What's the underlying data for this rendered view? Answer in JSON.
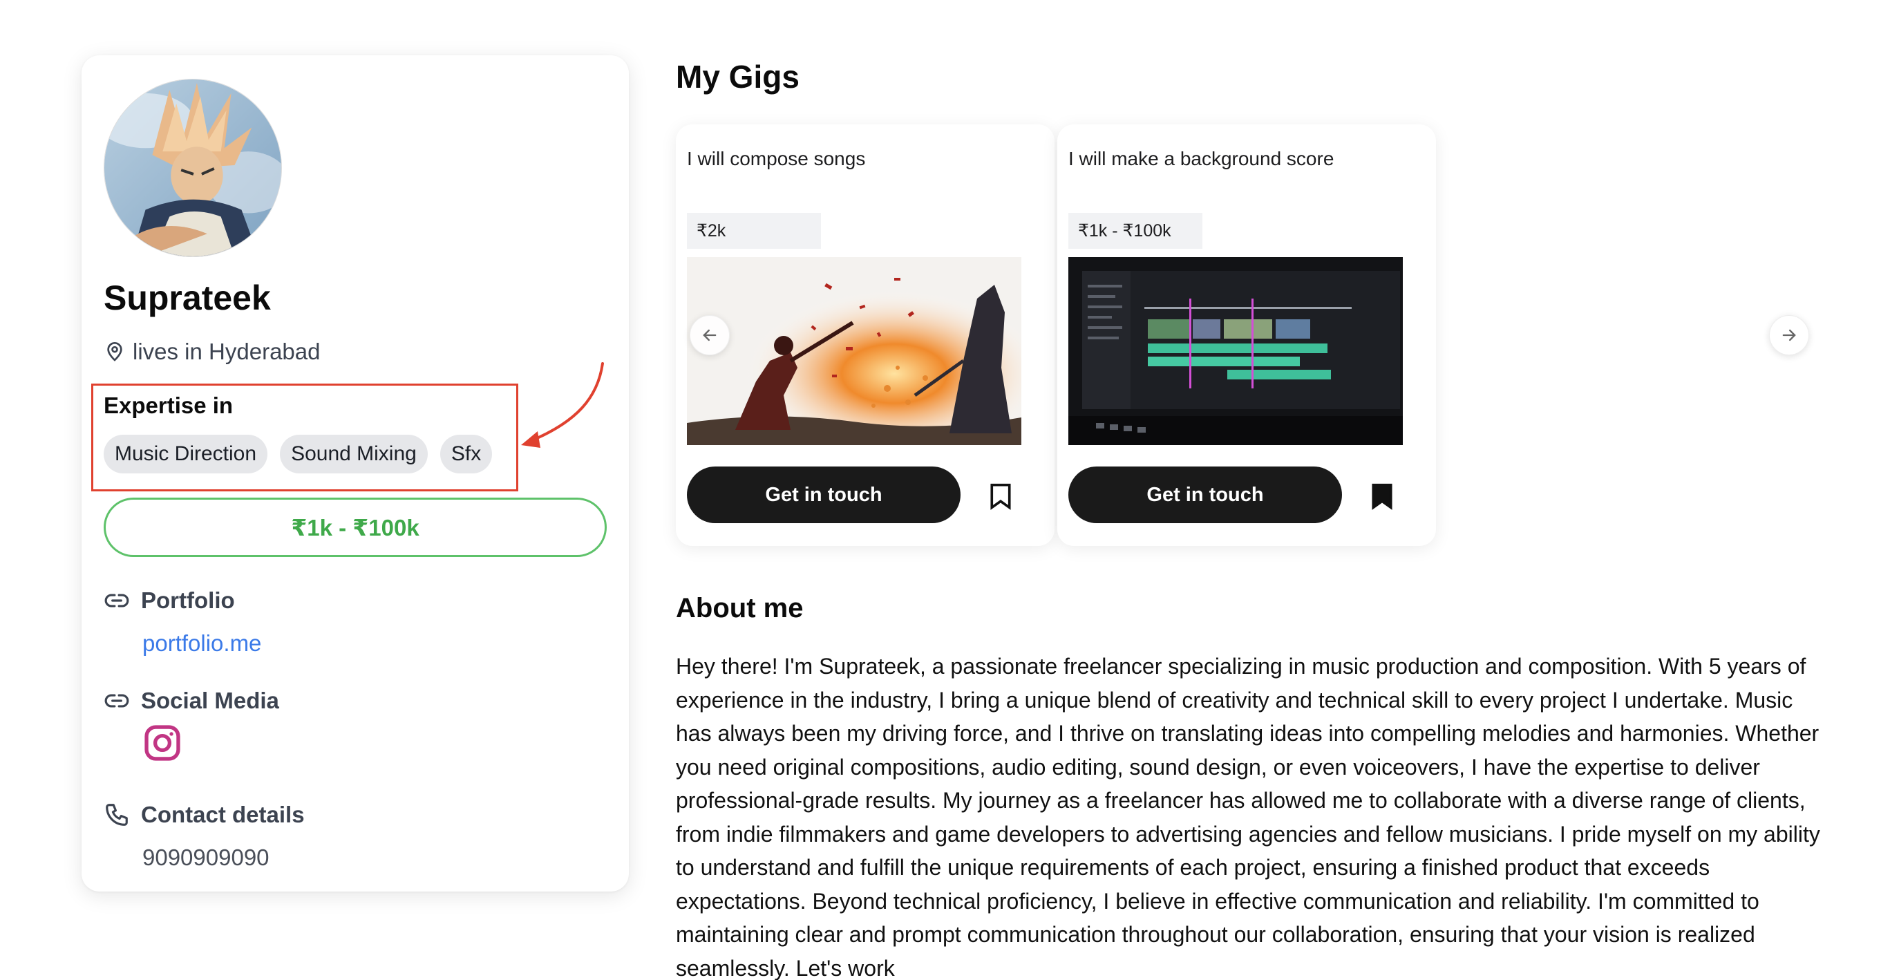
{
  "profile": {
    "name": "Suprateek",
    "location": "lives in Hyderabad",
    "expertise_title": "Expertise in",
    "expertise": [
      "Music Direction",
      "Sound Mixing",
      "Sfx"
    ],
    "price_range": "₹1k - ₹100k",
    "portfolio_label": "Portfolio",
    "portfolio_link": "portfolio.me",
    "social_label": "Social Media",
    "social_icons": [
      "instagram-icon"
    ],
    "contact_label": "Contact details",
    "phone": "9090909090"
  },
  "gigs_section": {
    "title": "My Gigs",
    "gigs": [
      {
        "title": "I will compose songs",
        "price": "₹2k",
        "button": "Get in touch",
        "bookmarked": false,
        "image": "silhouette-duel-artwork"
      },
      {
        "title": "I will make a background score",
        "price": "₹1k - ₹100k",
        "button": "Get in touch",
        "bookmarked": true,
        "image": "video-editor-timeline-screen"
      }
    ]
  },
  "about": {
    "title": "About me",
    "text": "Hey there! I'm Suprateek, a passionate freelancer specializing in music production and composition. With 5 years of experience in the industry, I bring a unique blend of creativity and technical skill to every project I undertake. Music has always been my driving force, and I thrive on translating ideas into compelling melodies and harmonies. Whether you need original compositions, audio editing, sound design, or even voiceovers, I have the expertise to deliver professional-grade results. My journey as a freelancer has allowed me to collaborate with a diverse range of clients, from indie filmmakers and game developers to advertising agencies and fellow musicians. I pride myself on my ability to understand and fulfill the unique requirements of each project, ensuring a finished product that exceeds expectations. Beyond technical proficiency, I believe in effective communication and reliability. I'm committed to maintaining clear and prompt communication throughout our collaboration, ensuring that your vision is realized seamlessly. Let's work"
  },
  "colors": {
    "annotation_red": "#e0412f",
    "price_green": "#3fa94a",
    "link_blue": "#3b7ae8",
    "button_dark": "#1a1a1a",
    "instagram": "#c13584"
  }
}
